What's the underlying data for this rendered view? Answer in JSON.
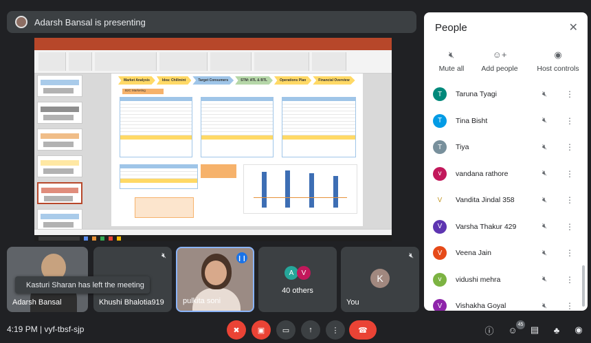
{
  "presenter": {
    "text": "Adarsh Bansal is presenting"
  },
  "shared_screen": {
    "chevrons": [
      "Market Analysis",
      "Idea: Chillmint",
      "Target Consumers",
      "STM: ATL & BTL",
      "Operations Plan",
      "Financial Overview"
    ],
    "tag": "B2C Marketing"
  },
  "tiles": [
    {
      "name": "Adarsh Bansal"
    },
    {
      "name": "Khushi Bhalotia919"
    },
    {
      "name": "pulkita soni"
    },
    {
      "name": "40 others",
      "initials": [
        "A",
        "V"
      ]
    },
    {
      "name": "You",
      "initial": "K"
    }
  ],
  "toast": "Kasturi Sharan has left the meeting",
  "bottom_bar": {
    "meeting_info": "4:19 PM  |  vyf-tbsf-sjp",
    "participant_badge": "45"
  },
  "people_panel": {
    "title": "People",
    "actions": [
      "Mute all",
      "Add people",
      "Host controls"
    ],
    "participants": [
      {
        "name": "Taruna Tyagi",
        "initial": "T",
        "color": "#00897b"
      },
      {
        "name": "Tina Bisht",
        "initial": "T",
        "color": "#039be5"
      },
      {
        "name": "Tiya",
        "initial": "T",
        "color": "#78909c"
      },
      {
        "name": "vandana rathore",
        "initial": "v",
        "color": "#c2185b"
      },
      {
        "name": "Vandita Jindal 358",
        "initial": "V",
        "color": "#ffffff"
      },
      {
        "name": "Varsha Thakur 429",
        "initial": "V",
        "color": "#5e35b1"
      },
      {
        "name": "Veena Jain",
        "initial": "V",
        "color": "#e64a19"
      },
      {
        "name": "vidushi mehra",
        "initial": "v",
        "color": "#7cb342"
      },
      {
        "name": "Vishakha Goyal",
        "initial": "V",
        "color": "#8e24aa"
      }
    ]
  }
}
